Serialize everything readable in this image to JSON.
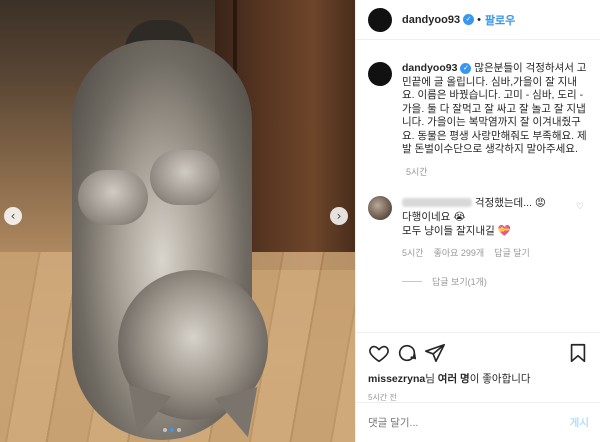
{
  "post": {
    "username": "dandyoo93",
    "follow_label": "팔로우",
    "caption_username": "dandyoo93",
    "caption": "많은분들이 걱정하셔서 고민끝에 글 올립니다. 심바,가을이 잘 지내요. 이름은 바꿨습니다. 고미 - 심바, 도리 - 가을. 둘 다 잘먹고 잘 싸고 잘 놀고 잘 지냅니다. 가을이는 복막염까지 잘 이겨내줬구요. 동물은 평생 사랑만해줘도 부족해요. 제발 돈벌이수단으로 생각하지 말아주세요.",
    "caption_time": "5시간"
  },
  "comment": {
    "text_1": "걱정했는데...",
    "emoji_1": "😡",
    "text_2": "다행이네요",
    "emoji_2": "😭",
    "text_3": "모두 냥이들 잘지내길",
    "emoji_3": "💝",
    "time": "5시간",
    "likes": "좋아요 299개",
    "reply": "답글 달기",
    "view_replies": "답글 보기(1개)"
  },
  "footer": {
    "liked_by_user": "missezryna",
    "liked_by_rest_1": "님 ",
    "liked_by_bold": "여러 명",
    "liked_by_rest_2": "이 좋아합니다",
    "time": "5시간 전",
    "comment_placeholder": "댓글 달기...",
    "post_label": "게시"
  },
  "carousel": {
    "prev_icon": "chevron-left-icon",
    "next_icon": "chevron-right-icon",
    "dots": 3,
    "active_dot": 1
  },
  "colors": {
    "accent": "#3897f0",
    "post_button_disabled": "#b2dffc"
  }
}
